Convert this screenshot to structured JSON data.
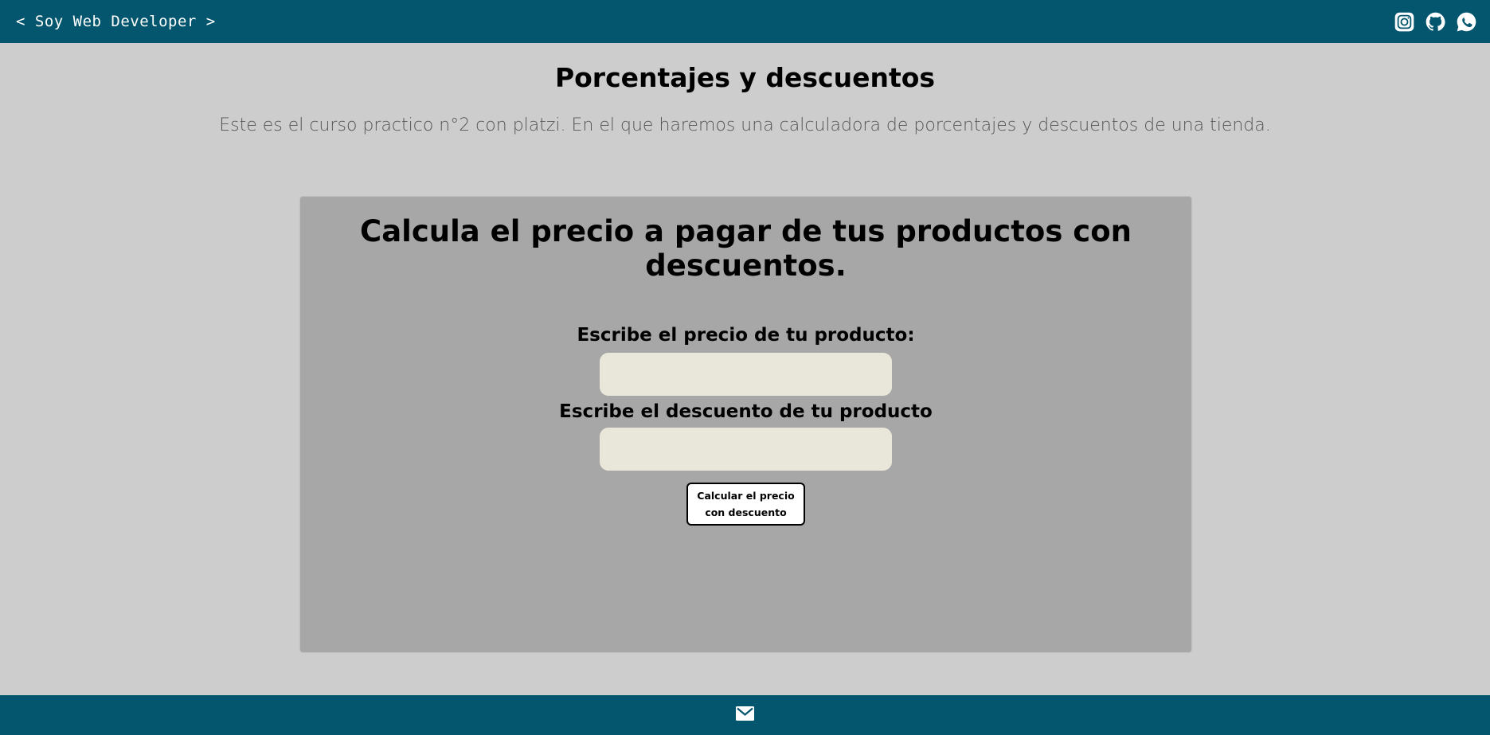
{
  "header": {
    "brand": "< Soy Web Developer >",
    "social_icons": [
      "instagram-icon",
      "github-icon",
      "whatsapp-icon"
    ],
    "background_color": "#03566d"
  },
  "page": {
    "title": "Porcentajes y descuentos",
    "intro": "Este es el curso practico n°2 con platzi. En el que haremos una calculadora de porcentajes y descuentos de una tienda.",
    "background_color": "#cdcdcd"
  },
  "calculator": {
    "title": "Calcula el precio a pagar de tus productos con descuentos.",
    "price_label": "Escribe el precio de tu producto:",
    "price_value": "",
    "discount_label": "Escribe el descuento de tu producto",
    "discount_value": "",
    "button_label": "Calcular el precio con descuento",
    "card_color": "#a7a7a7",
    "input_color": "#e8e7da"
  },
  "footer": {
    "icons": [
      "mail-icon"
    ]
  }
}
